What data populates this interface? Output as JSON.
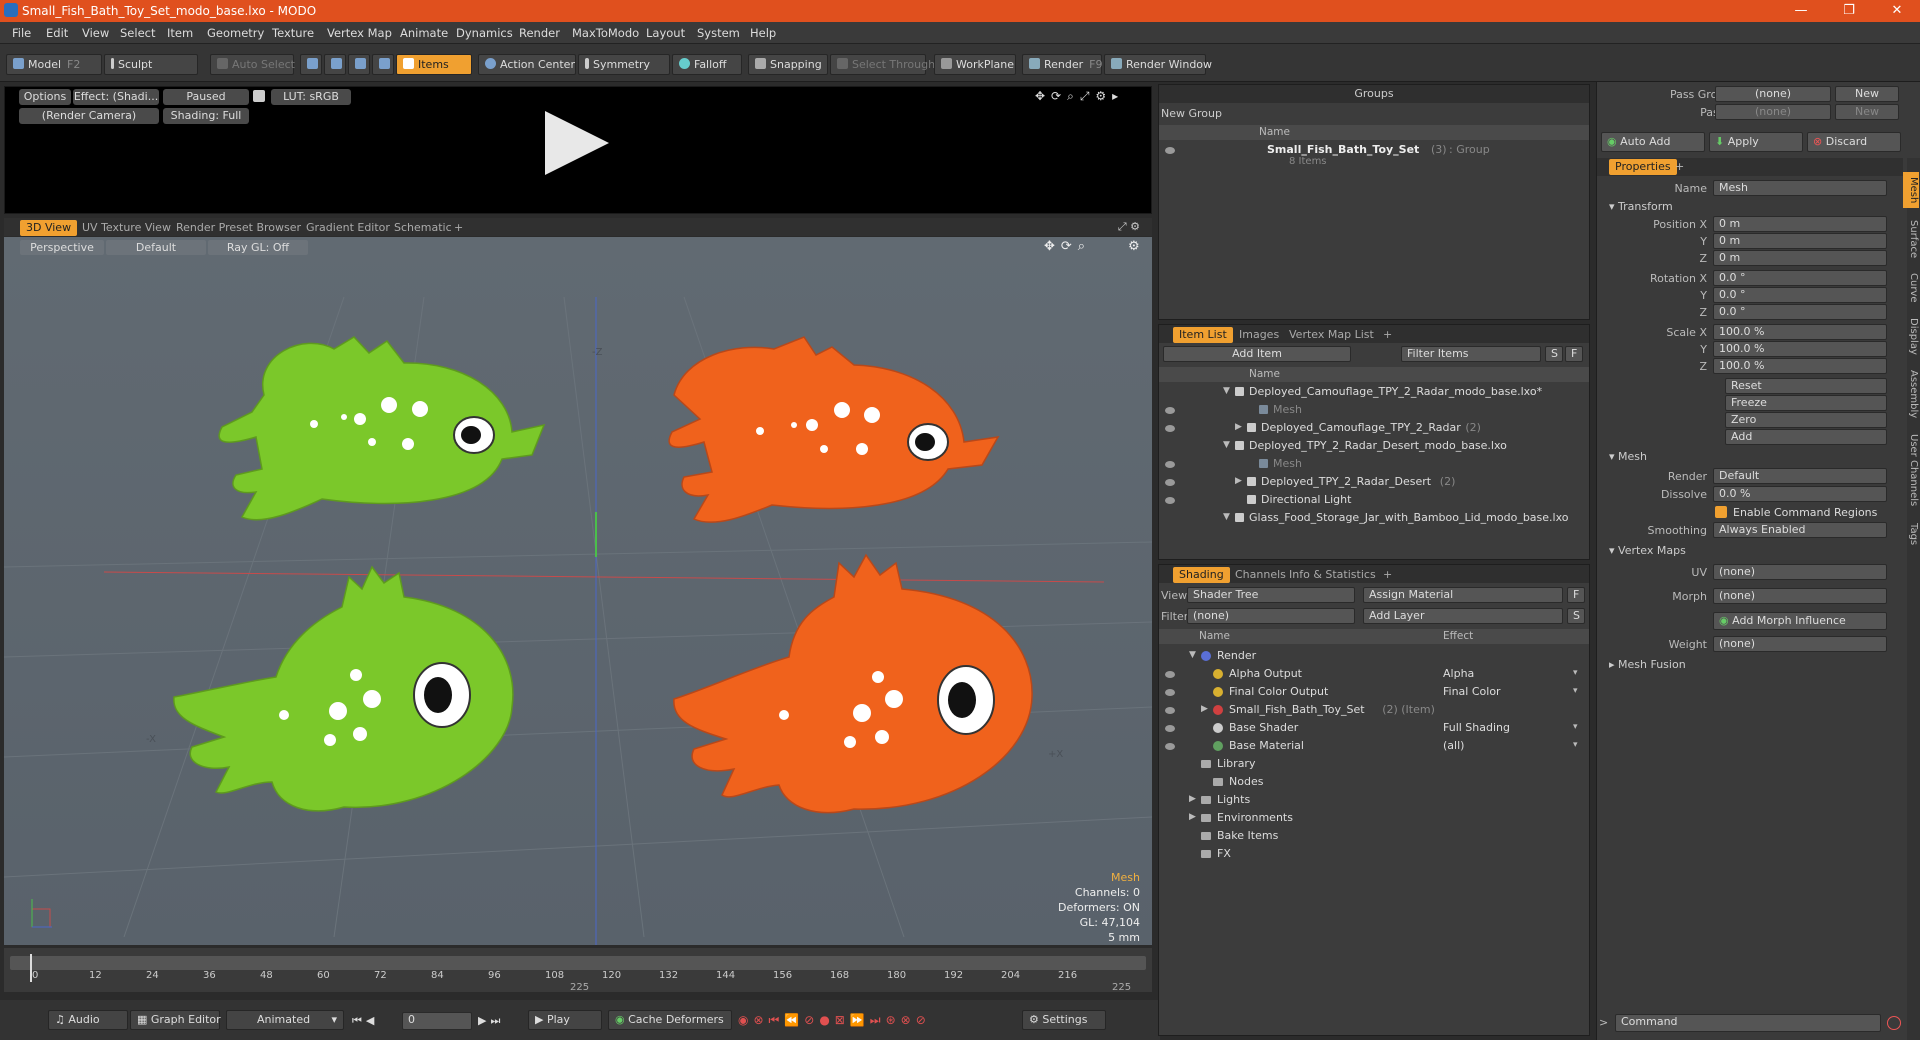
{
  "window": {
    "title": "Small_Fish_Bath_Toy_Set_modo_base.lxo - MODO",
    "minimize": "—",
    "maximize": "❐",
    "close": "✕"
  },
  "menu": [
    "File",
    "Edit",
    "View",
    "Select",
    "Item",
    "Geometry",
    "Texture",
    "Vertex Map",
    "Animate",
    "Dynamics",
    "Render",
    "MaxToModo",
    "Layout",
    "System",
    "Help"
  ],
  "toolbar": {
    "model": "Model",
    "model_key": "F2",
    "sculpt": "Sculpt",
    "auto_select": "Auto Select",
    "items": "Items",
    "action_center": "Action Center",
    "symmetry": "Symmetry",
    "falloff": "Falloff",
    "snapping": "Snapping",
    "select_through": "Select Through",
    "workplane": "WorkPlane",
    "render": "Render",
    "render_key": "F9",
    "render_window": "Render Window"
  },
  "preview": {
    "options": "Options",
    "effect": "Effect: (Shadi...",
    "paused": "Paused",
    "lut": "LUT: sRGB",
    "camera": "(Render Camera)",
    "shading": "Shading: Full"
  },
  "viewport_tabs": [
    "3D View",
    "UV Texture View",
    "Render Preset Browser",
    "Gradient Editor",
    "Schematic",
    "+"
  ],
  "viewport": {
    "perspective": "Perspective",
    "default": "Default",
    "raygl": "Ray GL: Off",
    "axis_neg_x": "-X",
    "axis_pos_x": "+X",
    "axis_neg_z": "-Z",
    "info": {
      "type": "Mesh",
      "channels": "Channels: 0",
      "deformers": "Deformers: ON",
      "gl": "GL: 47,104",
      "scale": "5 mm"
    }
  },
  "timeline": {
    "ticks": [
      "0",
      "12",
      "24",
      "36",
      "48",
      "60",
      "72",
      "84",
      "96",
      "108",
      "120",
      "132",
      "144",
      "156",
      "168",
      "180",
      "192",
      "204",
      "216"
    ],
    "mid": "225",
    "end": "225"
  },
  "bottom": {
    "audio": "Audio",
    "graph": "Graph Editor",
    "animated": "Animated",
    "frame": "0",
    "play": "Play",
    "cache": "Cache Deformers",
    "settings": "Settings"
  },
  "groups": {
    "title": "Groups",
    "new_group": "New Group",
    "col_name": "Name",
    "item_name": "Small_Fish_Bath_Toy_Set",
    "item_count": "(3)",
    "item_type": ": Group",
    "item_sub": "8 Items"
  },
  "itemlist": {
    "tabs": [
      "Item List",
      "Images",
      "Vertex Map List",
      "+"
    ],
    "add_item": "Add Item",
    "filter": "Filter Items",
    "s": "S",
    "f": "F",
    "col_name": "Name",
    "rows": [
      {
        "text": "Deployed_Camouflage_TPY_2_Radar_modo_base.lxo*",
        "indent": 0,
        "exp": "▼",
        "eye": false,
        "gray": false
      },
      {
        "text": "Mesh",
        "indent": 2,
        "exp": "",
        "eye": true,
        "gray": true
      },
      {
        "text": "Deployed_Camouflage_TPY_2_Radar",
        "extra": "(2)",
        "indent": 1,
        "exp": "▶",
        "eye": true,
        "gray": false
      },
      {
        "text": "Deployed_TPY_2_Radar_Desert_modo_base.lxo",
        "indent": 0,
        "exp": "▼",
        "eye": false,
        "gray": false
      },
      {
        "text": "Mesh",
        "indent": 2,
        "exp": "",
        "eye": true,
        "gray": true
      },
      {
        "text": "Deployed_TPY_2_Radar_Desert",
        "extra": "(2)",
        "indent": 1,
        "exp": "▶",
        "eye": true,
        "gray": false
      },
      {
        "text": "Directional Light",
        "indent": 1,
        "exp": "",
        "eye": true,
        "gray": false
      },
      {
        "text": "Glass_Food_Storage_Jar_with_Bamboo_Lid_modo_base.lxo",
        "indent": 0,
        "exp": "▼",
        "eye": false,
        "gray": false
      }
    ]
  },
  "shading": {
    "tabs": [
      "Shading",
      "Channels",
      "Info & Statistics",
      "+"
    ],
    "view_label": "View",
    "view_value": "Shader Tree",
    "assign": "Assign Material",
    "f": "F",
    "filter_label": "Filter",
    "filter_value": "(none)",
    "add_layer": "Add Layer",
    "s": "S",
    "col_name": "Name",
    "col_effect": "Effect",
    "rows": [
      {
        "text": "Render",
        "effect": "",
        "indent": 0,
        "exp": "▼",
        "eye": false,
        "dot": "#5a6fd6"
      },
      {
        "text": "Alpha Output",
        "effect": "Alpha",
        "indent": 1,
        "exp": "",
        "eye": true,
        "dot": "#d8b030"
      },
      {
        "text": "Final Color Output",
        "effect": "Final Color",
        "indent": 1,
        "exp": "",
        "eye": true,
        "dot": "#d8b030"
      },
      {
        "text": "Small_Fish_Bath_Toy_Set",
        "extra": "(2) (Item)",
        "effect": "",
        "indent": 1,
        "exp": "▶",
        "eye": true,
        "dot": "#d04040"
      },
      {
        "text": "Base Shader",
        "effect": "Full Shading",
        "indent": 1,
        "exp": "",
        "eye": true,
        "dot": "#cccccc"
      },
      {
        "text": "Base Material",
        "effect": "(all)",
        "indent": 1,
        "exp": "",
        "eye": true,
        "dot": "#60a060"
      },
      {
        "text": "Library",
        "effect": "",
        "indent": 0,
        "exp": "",
        "eye": false,
        "dot": ""
      },
      {
        "text": "Nodes",
        "effect": "",
        "indent": 1,
        "exp": "",
        "eye": false,
        "dot": ""
      },
      {
        "text": "Lights",
        "effect": "",
        "indent": 0,
        "exp": "▶",
        "eye": false,
        "dot": ""
      },
      {
        "text": "Environments",
        "effect": "",
        "indent": 0,
        "exp": "▶",
        "eye": false,
        "dot": ""
      },
      {
        "text": "Bake Items",
        "effect": "",
        "indent": 0,
        "exp": "",
        "eye": false,
        "dot": ""
      },
      {
        "text": "FX",
        "effect": "",
        "indent": 0,
        "exp": "",
        "eye": false,
        "dot": ""
      }
    ]
  },
  "properties": {
    "pass_groups": "Pass Groups",
    "passes": "Passes",
    "none": "(none)",
    "new": "New",
    "auto_add": "Auto Add",
    "apply": "Apply",
    "discard": "Discard",
    "title": "Properties",
    "plus": "+",
    "name_label": "Name",
    "name_value": "Mesh",
    "transform": "Transform",
    "position_label": "Position X",
    "rotation_label": "Rotation X",
    "scale_label": "Scale X",
    "y": "Y",
    "z": "Z",
    "pos": [
      "0 m",
      "0 m",
      "0 m"
    ],
    "rot": [
      "0.0 °",
      "0.0 °",
      "0.0 °"
    ],
    "scl": [
      "100.0 %",
      "100.0 %",
      "100.0 %"
    ],
    "reset": "Reset",
    "freeze": "Freeze",
    "zero": "Zero",
    "add": "Add",
    "mesh": "Mesh",
    "render_label": "Render",
    "render_value": "Default",
    "dissolve_label": "Dissolve",
    "dissolve_value": "0.0 %",
    "enable_cmd": "Enable Command Regions",
    "smoothing_label": "Smoothing",
    "smoothing_value": "Always Enabled",
    "vertex_maps": "Vertex Maps",
    "uv_label": "UV",
    "uv_value": "(none)",
    "morph_label": "Morph",
    "morph_value": "(none)",
    "add_morph": "Add Morph Influence",
    "weight_label": "Weight",
    "weight_value": "(none)",
    "mesh_fusion": "Mesh Fusion",
    "command": "Command",
    "side_tabs": [
      "Mesh",
      "Surface",
      "Curve",
      "Display",
      "Assembly",
      "User Channels",
      "Tags"
    ]
  },
  "colors": {
    "accent": "#f0a030",
    "title_bar": "#e0501e",
    "fish_green": "#7bc82a",
    "fish_orange": "#f0621c"
  }
}
